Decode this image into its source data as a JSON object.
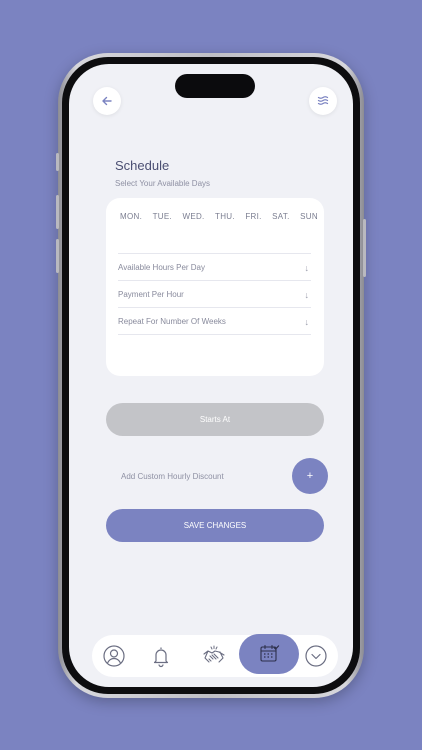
{
  "header": {
    "back_icon": "arrow-left-icon",
    "menu_icon": "waves-menu-icon"
  },
  "schedule": {
    "title": "Schedule",
    "subtitle": "Select Your Available Days",
    "days": [
      "MON.",
      "TUE.",
      "WED.",
      "THU.",
      "FRI.",
      "SAT.",
      "SUN"
    ],
    "fields": [
      {
        "label": "Available Hours Per Day",
        "icon": "arrow-down-icon"
      },
      {
        "label": "Payment Per Hour",
        "icon": "arrow-down-icon"
      },
      {
        "label": "Repeat For Number Of Weeks",
        "icon": "arrow-down-icon"
      }
    ]
  },
  "actions": {
    "starts_at": "Starts At",
    "discount_label": "Add Custom Hourly Discount",
    "plus": "+",
    "save": "SAVE CHANGES"
  },
  "nav": {
    "items": [
      "profile-icon",
      "bell-icon",
      "handshake-icon",
      "calendar-icon",
      "chevron-down-icon"
    ],
    "active": "calendar-icon"
  },
  "colors": {
    "background": "#7b83c1",
    "accent": "#7b83c1",
    "disabled": "#c3c4c8",
    "screen": "#f0f1f6"
  },
  "down_arrow_glyph": "↓"
}
